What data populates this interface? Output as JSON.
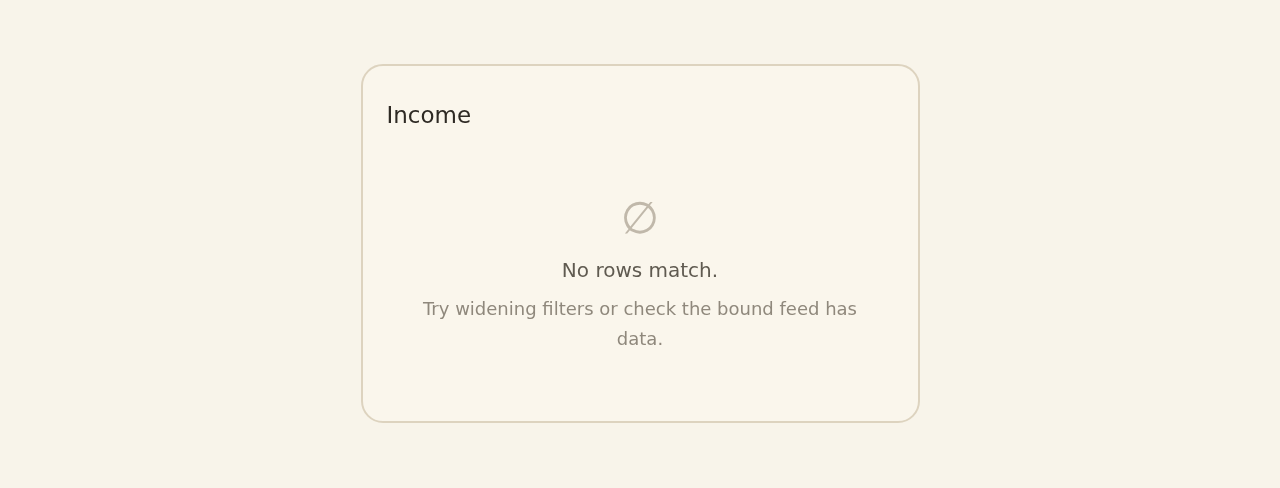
{
  "card": {
    "title": "Income",
    "empty_state": {
      "icon": "∅",
      "heading": "No rows match.",
      "message": "Try widening filters or check the bound feed has data."
    }
  }
}
